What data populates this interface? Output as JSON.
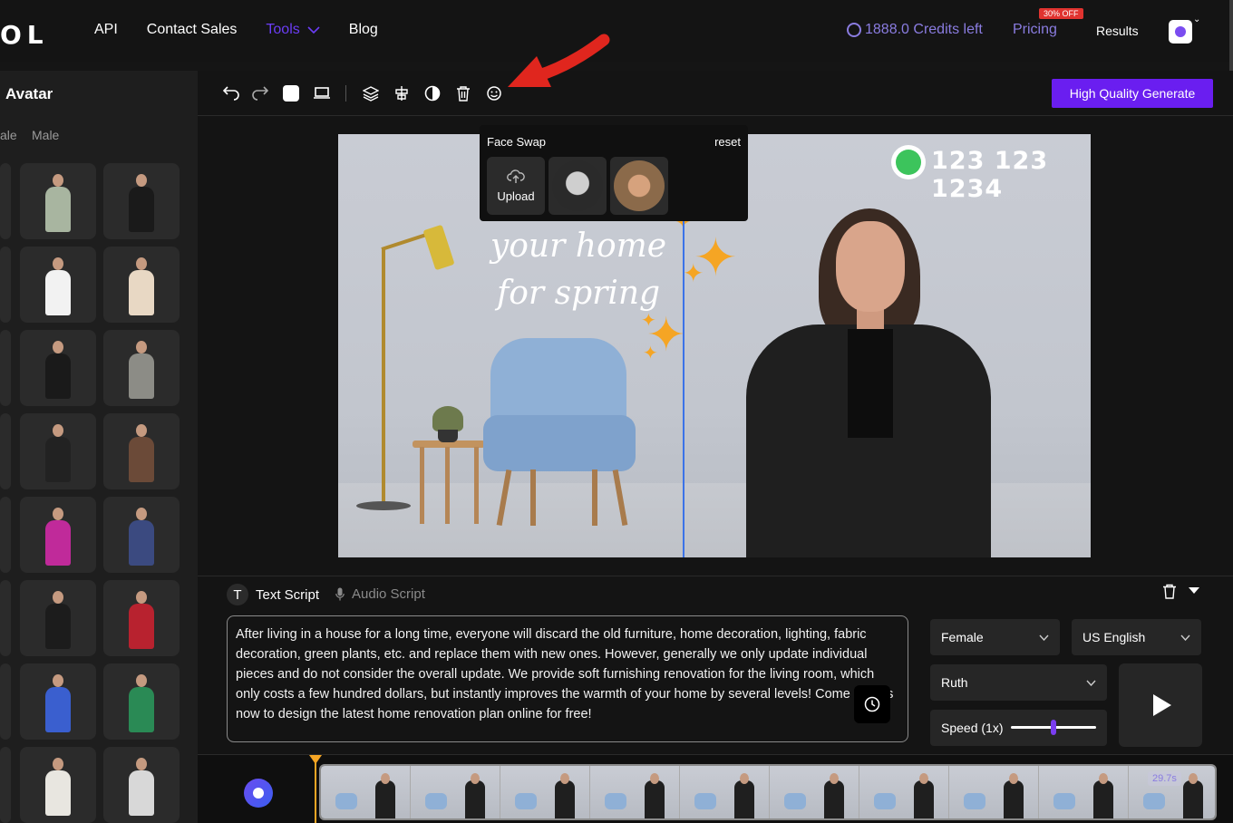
{
  "nav": {
    "logo": "OL",
    "links": [
      "API",
      "Contact Sales",
      "Tools",
      "Blog"
    ],
    "credits": "1888.0 Credits left",
    "pricing": "Pricing",
    "pricing_badge": "30% OFF",
    "results": "Results"
  },
  "left_panel": {
    "title": "Avatar",
    "tab_partial": "ale",
    "tab_male": "Male"
  },
  "toolbar": {
    "hq_button": "High Quality Generate"
  },
  "face_swap": {
    "title": "Face Swap",
    "reset": "reset",
    "upload": "Upload"
  },
  "canvas": {
    "phone": "123 123 1234",
    "headline_line1": "your home",
    "headline_line2": "for spring"
  },
  "script": {
    "tab_text": "Text Script",
    "tab_audio": "Audio Script",
    "body": "After living in a house for a long time, everyone will discard the old furniture, home decoration, lighting, fabric decoration, green plants, etc. and replace them with new ones. However, generally we only update individual pieces and do not consider the overall update. We provide soft furnishing renovation for the living room, which only costs a few hundred dollars, but instantly improves the warmth of your home by several levels! Come and us now to design the latest home renovation plan online for free!",
    "gender": "Female",
    "language": "US English",
    "voice": "Ruth",
    "speed_label": "Speed (1x)",
    "speed_value": 0.5
  },
  "timeline": {
    "duration": "29.7s"
  },
  "colors": {
    "accent": "#6a1ef0",
    "credits": "#8a7ce0",
    "badge": "#e0332f",
    "marker": "#f5a524"
  }
}
